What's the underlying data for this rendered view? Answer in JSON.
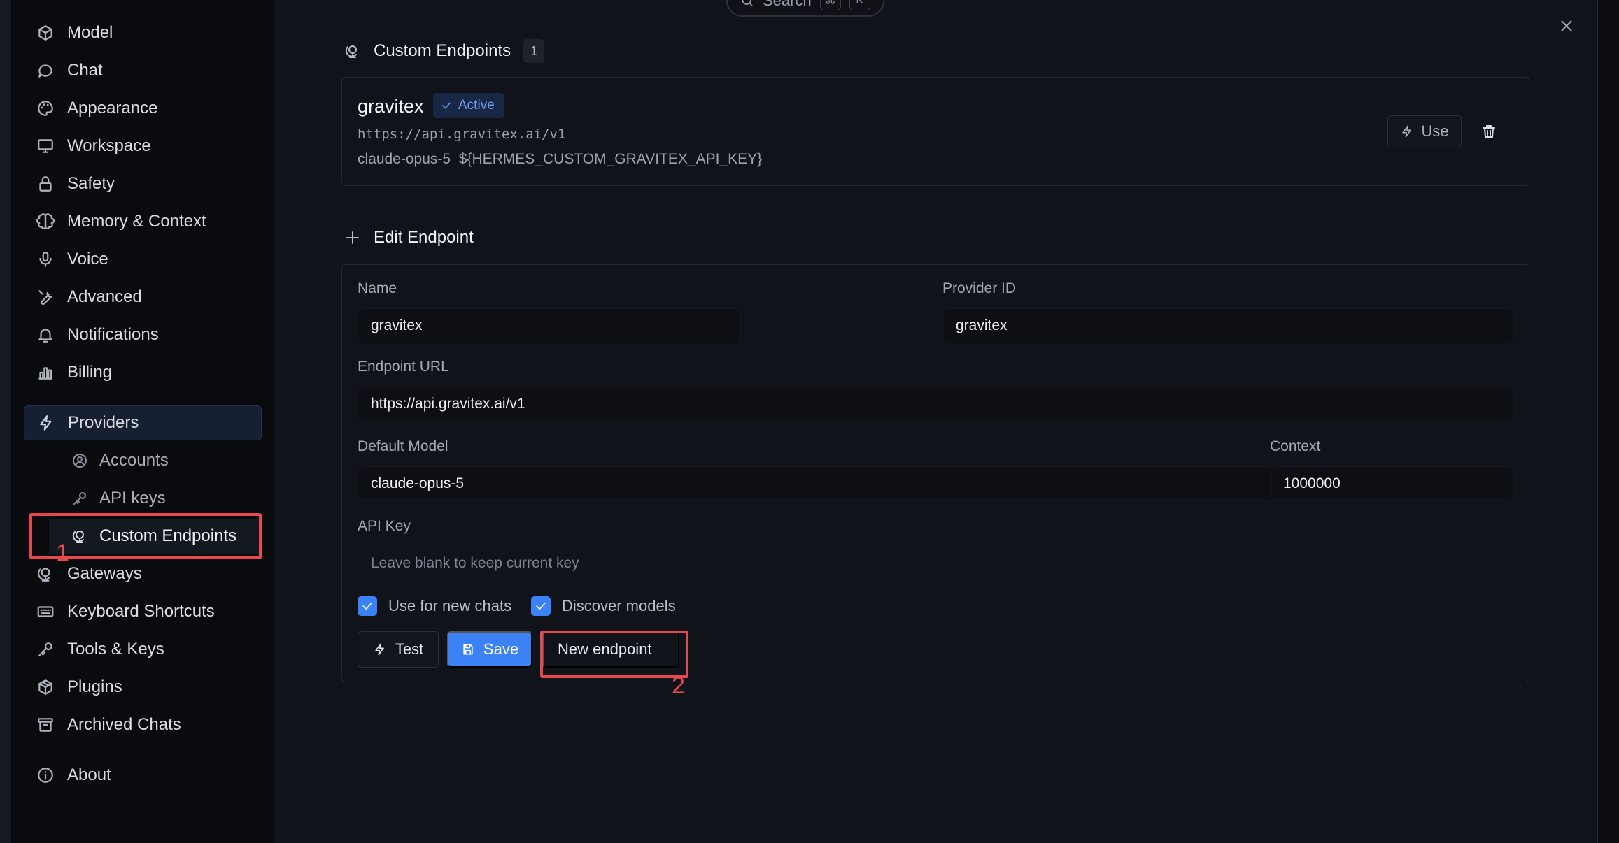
{
  "search": {
    "label": "Search",
    "shortcut_keys": [
      "⌘",
      "K"
    ]
  },
  "sidebar": {
    "items": [
      {
        "label": "Model",
        "icon": "cube-icon"
      },
      {
        "label": "Chat",
        "icon": "chat-bubble-icon"
      },
      {
        "label": "Appearance",
        "icon": "palette-icon"
      },
      {
        "label": "Workspace",
        "icon": "monitor-icon"
      },
      {
        "label": "Safety",
        "icon": "lock-icon"
      },
      {
        "label": "Memory & Context",
        "icon": "brain-icon"
      },
      {
        "label": "Voice",
        "icon": "microphone-icon"
      },
      {
        "label": "Advanced",
        "icon": "wrench-icon"
      },
      {
        "label": "Notifications",
        "icon": "bell-icon"
      },
      {
        "label": "Billing",
        "icon": "bar-chart-icon"
      },
      {
        "label": "Providers",
        "icon": "lightning-icon",
        "active": true
      },
      {
        "label": "Gateways",
        "icon": "globe-stand-icon"
      },
      {
        "label": "Keyboard Shortcuts",
        "icon": "keyboard-icon"
      },
      {
        "label": "Tools & Keys",
        "icon": "key-icon"
      },
      {
        "label": "Plugins",
        "icon": "package-icon"
      },
      {
        "label": "Archived Chats",
        "icon": "archive-icon"
      },
      {
        "label": "About",
        "icon": "info-icon"
      }
    ],
    "sub_items": [
      {
        "label": "Accounts",
        "icon": "user-circle-icon"
      },
      {
        "label": "API keys",
        "icon": "key-icon"
      },
      {
        "label": "Custom Endpoints",
        "icon": "globe-stand-icon",
        "current": true
      }
    ]
  },
  "annotations": {
    "first": "1",
    "second": "2",
    "color": "#e5484d"
  },
  "custom_endpoints": {
    "title": "Custom Endpoints",
    "count": "1",
    "endpoint": {
      "name": "gravitex",
      "status": "Active",
      "url": "https://api.gravitex.ai/v1",
      "model": "claude-opus-5",
      "api_key_env": "${HERMES_CUSTOM_GRAVITEX_API_KEY}",
      "use_label": "Use"
    }
  },
  "edit_endpoint": {
    "title": "Edit Endpoint",
    "name_label": "Name",
    "name_value": "gravitex",
    "provider_id_label": "Provider ID",
    "provider_id_value": "gravitex",
    "url_label": "Endpoint URL",
    "url_value": "https://api.gravitex.ai/v1",
    "default_model_label": "Default Model",
    "default_model_value": "claude-opus-5",
    "context_label": "Context",
    "context_value": "1000000",
    "api_key_label": "API Key",
    "api_key_placeholder": "Leave blank to keep current key",
    "use_for_new_chats_label": "Use for new chats",
    "use_for_new_chats_checked": true,
    "discover_models_label": "Discover models",
    "discover_models_checked": true,
    "test_label": "Test",
    "save_label": "Save",
    "new_endpoint_label": "New endpoint"
  },
  "colors": {
    "accent": "#3b82f6",
    "annotation": "#e5484d",
    "active_badge_text": "#6fa0f5"
  }
}
